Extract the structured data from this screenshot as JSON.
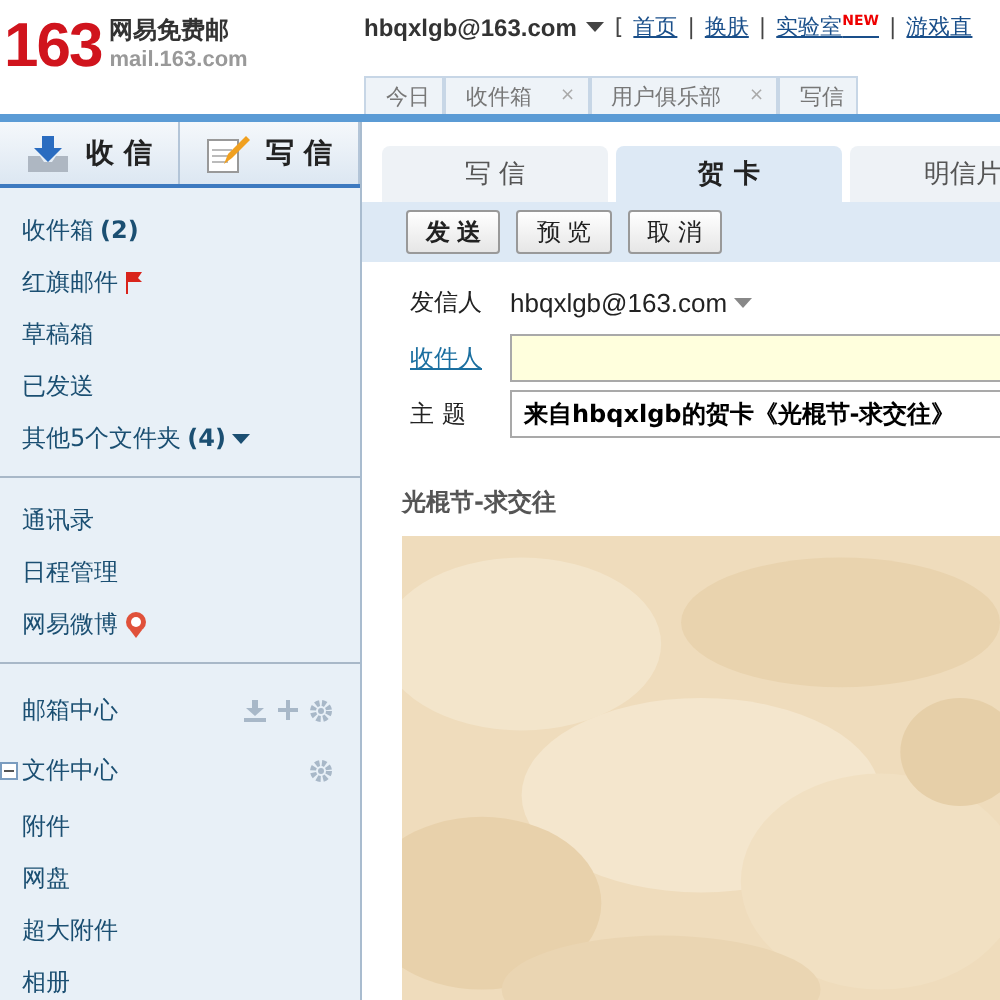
{
  "logo": {
    "number": "163",
    "name": "网易免费邮",
    "domain": "mail.163.com"
  },
  "account": {
    "address": "hbqxlgb@163.com"
  },
  "top_links": [
    {
      "kind": "bracket",
      "text": "["
    },
    {
      "kind": "link",
      "text": "首页"
    },
    {
      "kind": "sep",
      "text": "|"
    },
    {
      "kind": "link",
      "text": "换肤"
    },
    {
      "kind": "sep",
      "text": "|"
    },
    {
      "kind": "link",
      "text": "实验室",
      "badge": "NEW"
    },
    {
      "kind": "sep",
      "text": "|"
    },
    {
      "kind": "link",
      "text": "游戏直"
    }
  ],
  "top_tabs": [
    {
      "label": "今日",
      "closable": false
    },
    {
      "label": "收件箱",
      "closable": true,
      "close": "×"
    },
    {
      "label": "用户俱乐部",
      "closable": true,
      "close": "×"
    },
    {
      "label": "写信",
      "closable": false
    }
  ],
  "sidebar": {
    "buttons": [
      {
        "kind": "receive",
        "label": "收 信"
      },
      {
        "kind": "compose",
        "label": "写 信"
      }
    ],
    "groups": [
      {
        "items": [
          {
            "label": "收件箱",
            "count": "(2)",
            "kind": "plain"
          },
          {
            "label": "红旗邮件",
            "kind": "flag"
          },
          {
            "label": "草稿箱",
            "kind": "plain"
          },
          {
            "label": "已发送",
            "kind": "plain"
          },
          {
            "label": "其他5个文件夹",
            "count": "(4)",
            "kind": "more"
          }
        ]
      },
      {
        "items": [
          {
            "label": "通讯录",
            "kind": "plain"
          },
          {
            "label": "日程管理",
            "kind": "plain"
          },
          {
            "label": "网易微博",
            "kind": "weibo"
          }
        ]
      },
      {
        "sections": [
          {
            "title": "邮箱中心",
            "kind": "mail"
          },
          {
            "title": "文件中心",
            "kind": "files",
            "expanded": true,
            "children": [
              {
                "label": "附件"
              },
              {
                "label": "网盘"
              },
              {
                "label": "超大附件"
              },
              {
                "label": "相册"
              }
            ]
          }
        ]
      }
    ]
  },
  "compose": {
    "tabs": [
      {
        "label": "写 信",
        "selected": false
      },
      {
        "label": "贺 卡",
        "selected": true
      },
      {
        "label": "明信片",
        "selected": false
      }
    ],
    "toolbar": [
      {
        "label": "发 送",
        "primary": true
      },
      {
        "label": "预 览",
        "primary": false
      },
      {
        "label": "取 消",
        "primary": false
      }
    ],
    "from": {
      "label": "发信人",
      "value": "hbqxlgb@163.com"
    },
    "to": {
      "label": "收件人"
    },
    "subject": {
      "label": "主 题",
      "value": "来自hbqxlgb的贺卡《光棍节-求交往》"
    },
    "card": {
      "title": "光棍节-求交往",
      "kind": "picture"
    }
  }
}
